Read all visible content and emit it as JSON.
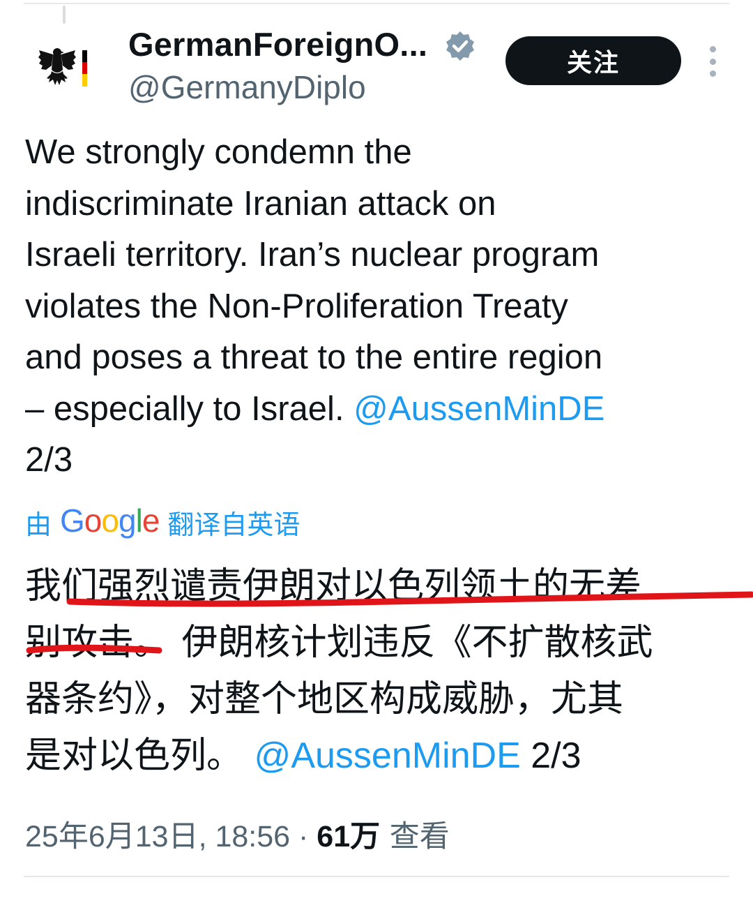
{
  "author": {
    "name": "GermanForeignO...",
    "handle": "@GermanyDiplo",
    "verified": true,
    "avatar_icon": "federal-eagle-logo"
  },
  "actions": {
    "follow_label": "关注",
    "more_icon": "more-vertical-icon"
  },
  "tweet": {
    "lines": [
      "We strongly condemn the",
      "indiscriminate Iranian attack on",
      "Israeli territory. Iran’s nuclear program",
      "violates the Non-Proliferation Treaty",
      "and poses a threat to the entire region"
    ],
    "last_line_prefix": "– especially to Israel. ",
    "mention": "@AussenMinDE",
    "thread_count": "2/3"
  },
  "translation": {
    "by": "由",
    "brand": "Google",
    "from": "翻译自英语",
    "lines": [
      "我们强烈谴责伊朗对以色列领土的无差",
      "别攻击。 伊朗核计划违反《不扩散核武",
      "器条约》，对整个地区构成威胁，尤其"
    ],
    "last_line_prefix": "是对以色列。 ",
    "mention": "@AussenMinDE",
    "thread_count": " 2/3"
  },
  "meta": {
    "timestamp": "25年6月13日, 18:56",
    "separator": " · ",
    "views_count": "61万",
    "views_label": " 查看"
  },
  "colors": {
    "link": "#1d9bf0",
    "secondary_text": "#536471",
    "primary_text": "#0f1419",
    "annotation": "#e0151a"
  }
}
